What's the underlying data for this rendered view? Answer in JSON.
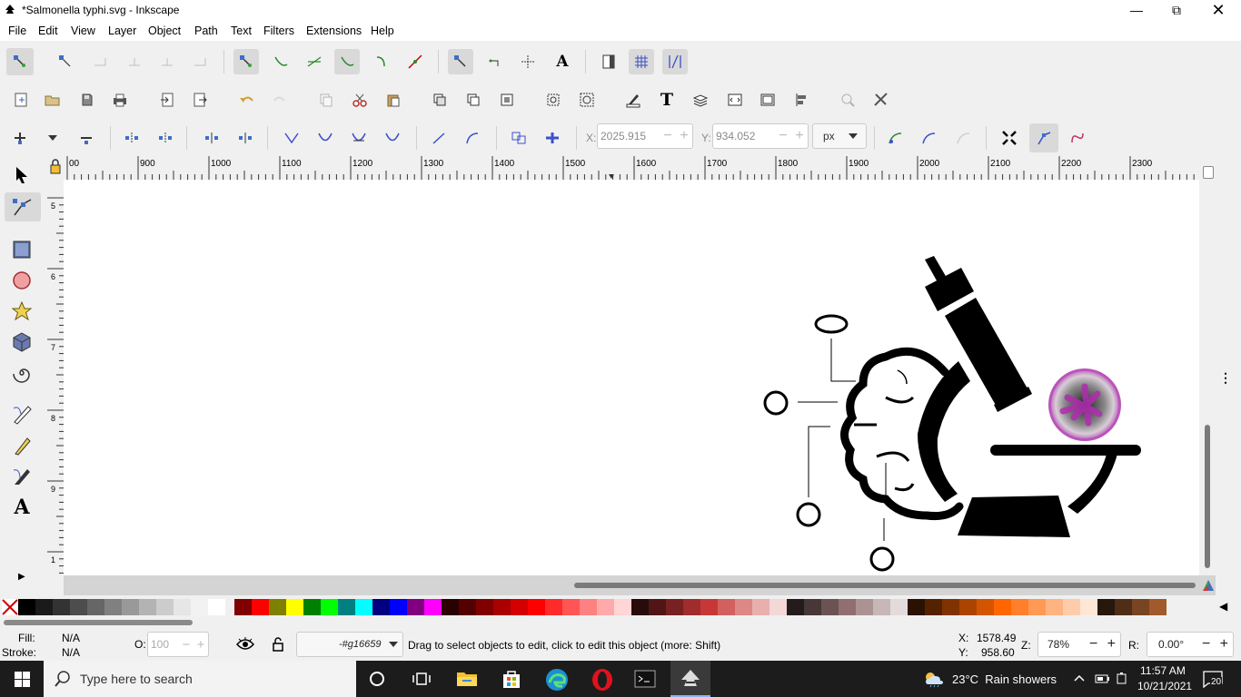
{
  "window": {
    "title": "*Salmonella typhi.svg - Inkscape"
  },
  "menu": [
    "File",
    "Edit",
    "View",
    "Layer",
    "Object",
    "Path",
    "Text",
    "Filters",
    "Extensions",
    "Help"
  ],
  "node_toolbar": {
    "x_label": "X:",
    "x_value": "2025.915",
    "y_label": "Y:",
    "y_value": "934.052",
    "unit": "px"
  },
  "ruler": {
    "h_labels": [
      "00",
      "900",
      "1000",
      "1100",
      "1200",
      "1300",
      "1400",
      "1500",
      "1600",
      "1700",
      "1800",
      "1900",
      "2000",
      "2100",
      "2200",
      "2300"
    ],
    "v_labels": [
      "5",
      "6",
      "7",
      "8",
      "9",
      "1"
    ]
  },
  "palette": {
    "colors": [
      "#000000",
      "#1a1a1a",
      "#333333",
      "#4d4d4d",
      "#666666",
      "#808080",
      "#999999",
      "#b3b3b3",
      "#cccccc",
      "#e6e6e6",
      "#f2f2f2",
      "#ffffff",
      "#800000",
      "#ff0000",
      "#808000",
      "#ffff00",
      "#008000",
      "#00ff00",
      "#008080",
      "#00ffff",
      "#000080",
      "#0000ff",
      "#800080",
      "#ff00ff",
      "#2b0000",
      "#550000",
      "#800000",
      "#aa0000",
      "#d40000",
      "#ff0000",
      "#ff2a2a",
      "#ff5555",
      "#ff8080",
      "#ffaaaa",
      "#ffd5d5",
      "#280b0b",
      "#501616",
      "#782121",
      "#a02c2c",
      "#c83737",
      "#d35f5f",
      "#de8787",
      "#e9afaf",
      "#f4d7d7",
      "#241c1c",
      "#483737",
      "#6c5353",
      "#916f6f",
      "#ac9393",
      "#c8b7b7",
      "#e3dbdb",
      "#2b1100",
      "#552200",
      "#803300",
      "#aa4400",
      "#d45500",
      "#ff6600",
      "#ff7f2a",
      "#ff9955",
      "#ffb380",
      "#ffccaa",
      "#ffe6d5",
      "#28170b",
      "#502d16",
      "#784421",
      "#a05a2c"
    ]
  },
  "status": {
    "fill_label": "Fill:",
    "fill_value": "N/A",
    "stroke_label": "Stroke:",
    "stroke_value": "N/A",
    "opacity_label": "O:",
    "opacity_value": "100",
    "layer": "-#g16659",
    "message": "Drag to select objects to edit, click to edit this object (more: Shift)",
    "cursor_x_label": "X:",
    "cursor_x": "1578.49",
    "cursor_y_label": "Y:",
    "cursor_y": "958.60",
    "zoom_label": "Z:",
    "zoom": "78%",
    "rotate_label": "R:",
    "rotate": "0.00°"
  },
  "taskbar": {
    "search_placeholder": "Type here to search",
    "weather": "23°C  Rain showers",
    "time": "11:57 AM",
    "date": "10/21/2021",
    "notifications": "20"
  }
}
